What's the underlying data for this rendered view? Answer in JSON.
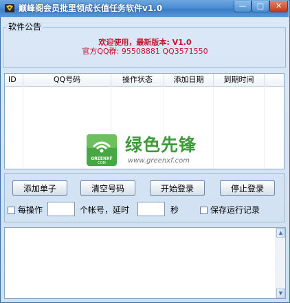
{
  "window": {
    "title": "巅峰阁会员批里领成长值任务软件v1.0",
    "controls": {
      "minimize": "—",
      "maximize": "□",
      "close": "✕"
    },
    "icons": {
      "app": "app-icon"
    }
  },
  "notice": {
    "legend": "软件公告",
    "line1": "欢迎使用，最新版本: V1.0",
    "line2": "官方QQ群: 95508881   QQ3571550",
    "color": "#c8102e"
  },
  "table": {
    "columns": [
      "ID",
      "QQ号码",
      "操作状态",
      "添加日期",
      "到期时间"
    ],
    "rows": []
  },
  "watermark": {
    "title": "绿色先锋",
    "url": "www.greenxf.com",
    "badge": "GREENXF\nCOM",
    "color": "#3f9a3b"
  },
  "controls": {
    "buttons": {
      "add": "添加单子",
      "clear": "清空号码",
      "start": "开始登录",
      "stop": "停止登录"
    },
    "per_op_label": "每操作",
    "accounts_delay_label": "个帐号，延时",
    "seconds_label": "秒",
    "save_log_label": "保存运行记录",
    "per_op_value": "",
    "delay_value": "",
    "per_op_checked": false,
    "save_log_checked": false
  },
  "log": {
    "content": ""
  }
}
